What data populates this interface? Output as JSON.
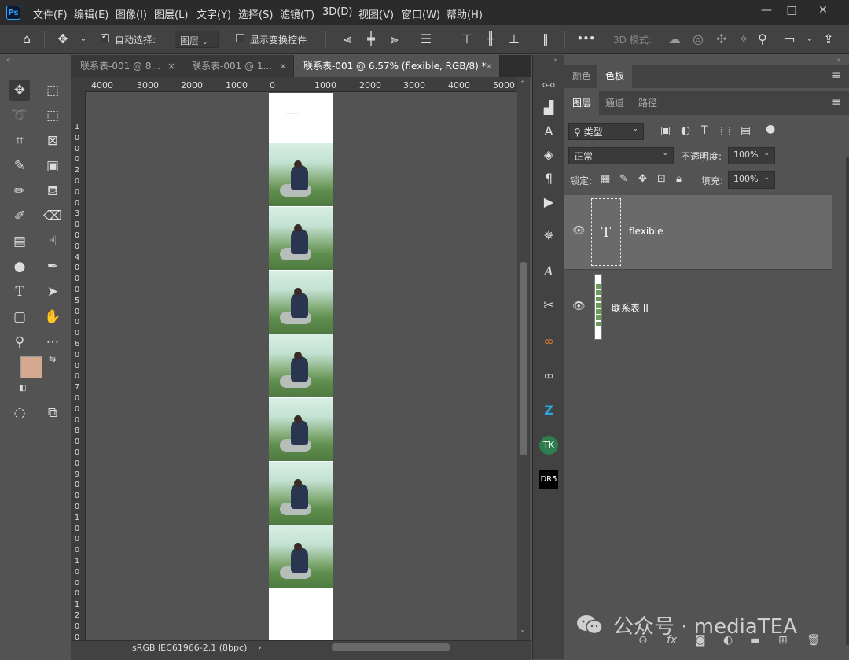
{
  "app": {
    "logo": "Ps"
  },
  "menu": [
    "文件(F)",
    "编辑(E)",
    "图像(I)",
    "图层(L)",
    "文字(Y)",
    "选择(S)",
    "滤镜(T)",
    "3D(D)",
    "视图(V)",
    "窗口(W)",
    "帮助(H)"
  ],
  "window_controls": {
    "minimize": "—",
    "restore": "□",
    "close": "✕"
  },
  "options": {
    "auto_select_label": "自动选择:",
    "auto_select_checked": true,
    "auto_select_target": "图层",
    "show_transform_label": "显示变换控件",
    "show_transform_checked": false,
    "more": "•••",
    "mode_3d_label": "3D 模式:"
  },
  "tabs": [
    {
      "label": "联系表-001 @ 8..."
    },
    {
      "label": "联系表-001 @ 1..."
    },
    {
      "label": "联系表-001 @ 6.57% (flexible, RGB/8) *"
    }
  ],
  "ruler_h": [
    "4000",
    "3000",
    "2000",
    "1000",
    "0",
    "1000",
    "2000",
    "3000",
    "4000",
    "5000"
  ],
  "ruler_v": [
    "1",
    "0",
    "0",
    "0",
    "2",
    "0",
    "0",
    "0",
    "3",
    "0",
    "0",
    "0",
    "4",
    "0",
    "0",
    "0",
    "5",
    "0",
    "0",
    "0",
    "6",
    "0",
    "0",
    "0",
    "7",
    "0",
    "0",
    "0",
    "8",
    "0",
    "0",
    "0",
    "9",
    "0",
    "0",
    "0",
    "1",
    "0",
    "0",
    "0",
    "1",
    "0",
    "0",
    "0",
    "1",
    "2",
    "0",
    "0"
  ],
  "document_caption": "· · · · · ·",
  "photos_count": 7,
  "status": {
    "profile": "sRGB IEC61966-2.1 (8bpc)",
    "arrow": "›"
  },
  "colors": {
    "foreground": "#d4a88e",
    "background": "#000000"
  },
  "panels": {
    "top_tabs": [
      "颜色",
      "色板"
    ],
    "layer_tabs": [
      "图层",
      "通道",
      "路径"
    ],
    "filter_type": "类型",
    "blend_mode": "正常",
    "opacity_label": "不透明度:",
    "opacity_value": "100%",
    "lock_label": "锁定:",
    "fill_label": "填充:",
    "fill_value": "100%",
    "layers": [
      {
        "name": "flexible",
        "thumb": "T",
        "selected": true
      },
      {
        "name": "联系表 II",
        "thumb": "image",
        "selected": false
      }
    ]
  },
  "watermark": "公众号 · mediaTEA",
  "tools": [
    "move-tool",
    "marquee-tool",
    "lasso-tool",
    "object-select-tool",
    "crop-tool",
    "frame-tool",
    "eyedropper-tool",
    "patch-tool",
    "brush-tool",
    "stamp-tool",
    "history-brush-tool",
    "eraser-tool",
    "gradient-tool",
    "smudge-tool",
    "dodge-tool",
    "pen-tool",
    "type-tool",
    "path-select-tool",
    "shape-tool",
    "hand-tool",
    "zoom-tool",
    "more-tools"
  ]
}
